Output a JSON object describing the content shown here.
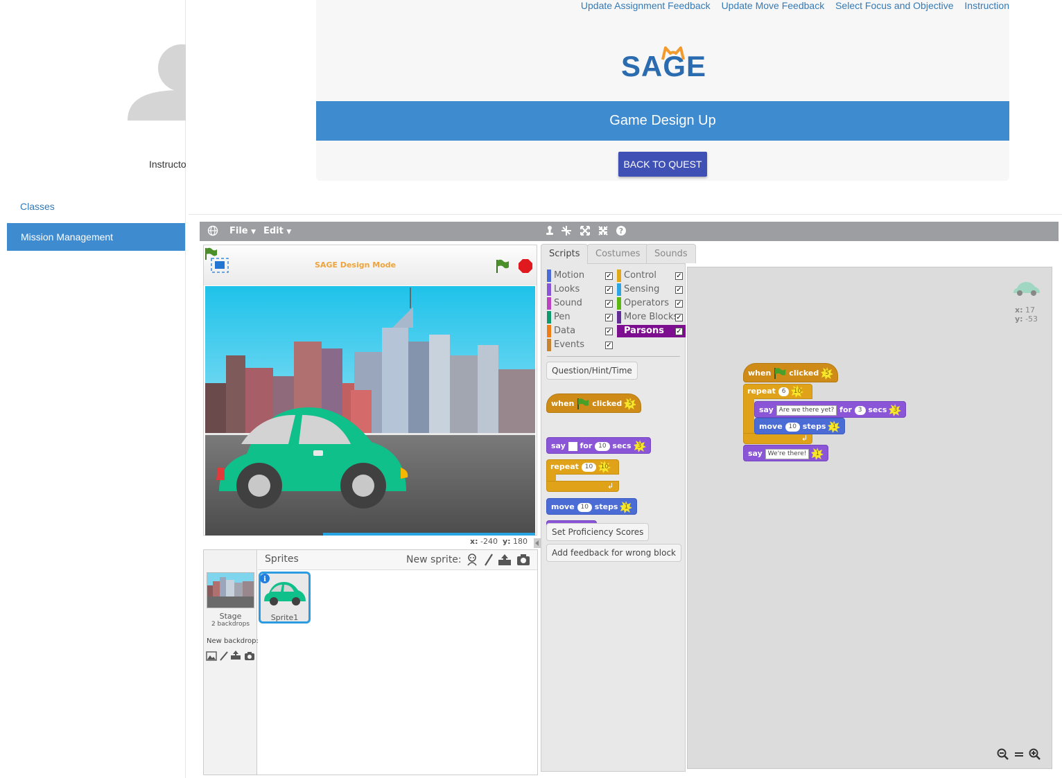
{
  "sidebar": {
    "role": "Instructor",
    "nav": [
      {
        "label": "Classes"
      },
      {
        "label": "Mission Management"
      }
    ]
  },
  "header": {
    "links": [
      {
        "label": "Update Assignment Feedback"
      },
      {
        "label": "Update Move Feedback"
      },
      {
        "label": "Select Focus and Objective"
      },
      {
        "label": "Instruction"
      }
    ],
    "logo": "SAGE",
    "banner_title": "Game Design Up",
    "back_button": "BACK TO QUEST"
  },
  "scratch": {
    "menu": {
      "file": "File",
      "edit": "Edit"
    },
    "stage": {
      "title": "SAGE Design Mode",
      "coords": {
        "x_label": "x:",
        "x": "-240",
        "y_label": "y:",
        "y": "180"
      }
    },
    "sprites": {
      "header": "Sprites",
      "new_sprite": "New sprite:",
      "stage_label": "Stage",
      "backdrops": "2 backdrops",
      "new_backdrop": "New backdrop:",
      "items": [
        {
          "name": "Sprite1"
        }
      ]
    },
    "tabs": [
      {
        "label": "Scripts"
      },
      {
        "label": "Costumes"
      },
      {
        "label": "Sounds"
      }
    ],
    "categories": [
      {
        "label": "Motion",
        "color": "#4a6cd4"
      },
      {
        "label": "Looks",
        "color": "#8a55d7"
      },
      {
        "label": "Sound",
        "color": "#bb42c3"
      },
      {
        "label": "Pen",
        "color": "#0e9a6c"
      },
      {
        "label": "Data",
        "color": "#ee7d16"
      },
      {
        "label": "Events",
        "color": "#c88330"
      },
      {
        "label": "Control",
        "color": "#e1a91a"
      },
      {
        "label": "Sensing",
        "color": "#2ca5e2"
      },
      {
        "label": "Operators",
        "color": "#5cb712"
      },
      {
        "label": "More Blocks",
        "color": "#632d99"
      },
      {
        "label": "Parsons",
        "color": "#7c0e8f"
      }
    ],
    "palette_buttons": {
      "question": "Question/Hint/Time",
      "proficiency": "Set Proficiency Scores",
      "feedback": "Add feedback for wrong block"
    },
    "palette_blocks": {
      "when": "when",
      "clicked": "clicked",
      "when_points": "5",
      "say": "say",
      "for": "for",
      "secs": "secs",
      "say_secs": "10",
      "say_for_points": "3",
      "repeat": "repeat",
      "repeat_count": "10",
      "repeat_points": "10",
      "move": "move",
      "steps": "steps",
      "move_steps": "10",
      "move_points": "1",
      "say_points": "1"
    },
    "script": {
      "when_points": "5",
      "repeat_count": "6",
      "repeat_points": "10",
      "say_text": "Are we there yet?",
      "say_secs": "3",
      "say_points": "3",
      "move_steps": "10",
      "move_points": "1",
      "final_say_text": "We're there!",
      "final_say_points": "1"
    },
    "sprite_info": {
      "x_label": "x:",
      "x": "17",
      "y_label": "y:",
      "y": "-53"
    }
  }
}
